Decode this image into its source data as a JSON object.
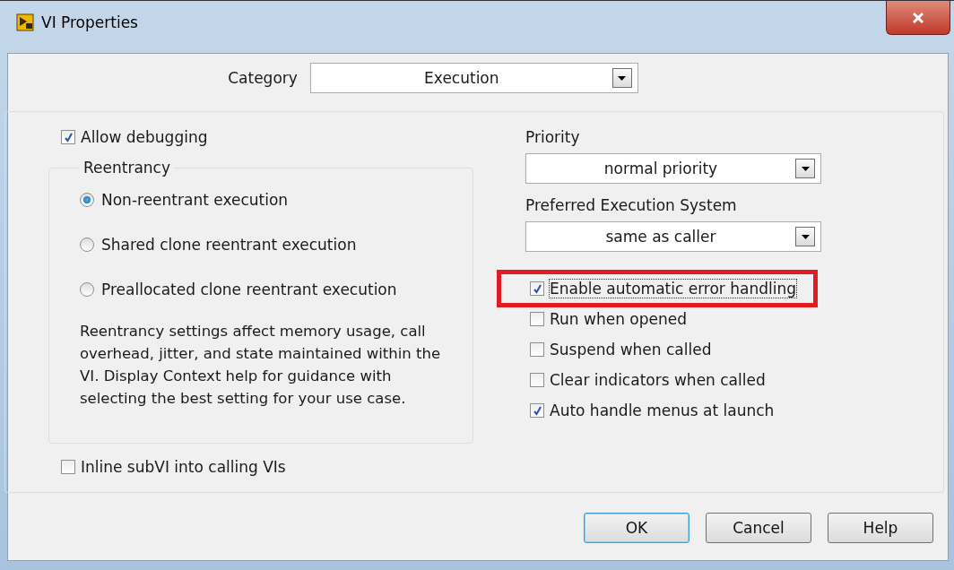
{
  "window": {
    "title": "VI Properties"
  },
  "category": {
    "label": "Category",
    "value": "Execution"
  },
  "allow_debugging": {
    "label": "Allow debugging",
    "checked": true
  },
  "reentrancy": {
    "title": "Reentrancy",
    "options": [
      {
        "label": "Non-reentrant execution",
        "selected": true
      },
      {
        "label": "Shared clone reentrant execution",
        "selected": false
      },
      {
        "label": "Preallocated clone reentrant execution",
        "selected": false
      }
    ],
    "note": "Reentrancy settings affect memory usage, call overhead, jitter, and state maintained within the VI. Display Context help for guidance with selecting the best setting for your use case."
  },
  "inline_subvi": {
    "label": "Inline subVI into calling VIs",
    "checked": false
  },
  "priority": {
    "label": "Priority",
    "value": "normal priority"
  },
  "execution_system": {
    "label": "Preferred Execution System",
    "value": "same as caller"
  },
  "options": [
    {
      "label": "Enable automatic error handling",
      "checked": true,
      "highlighted": true,
      "focused": true
    },
    {
      "label": "Run when opened",
      "checked": false,
      "highlighted": false,
      "focused": false
    },
    {
      "label": "Suspend when called",
      "checked": false,
      "highlighted": false,
      "focused": false
    },
    {
      "label": "Clear indicators when called",
      "checked": false,
      "highlighted": false,
      "focused": false
    },
    {
      "label": "Auto handle menus at launch",
      "checked": true,
      "highlighted": false,
      "focused": false
    }
  ],
  "buttons": [
    {
      "label": "OK",
      "default": true
    },
    {
      "label": "Cancel",
      "default": false
    },
    {
      "label": "Help",
      "default": false
    }
  ]
}
